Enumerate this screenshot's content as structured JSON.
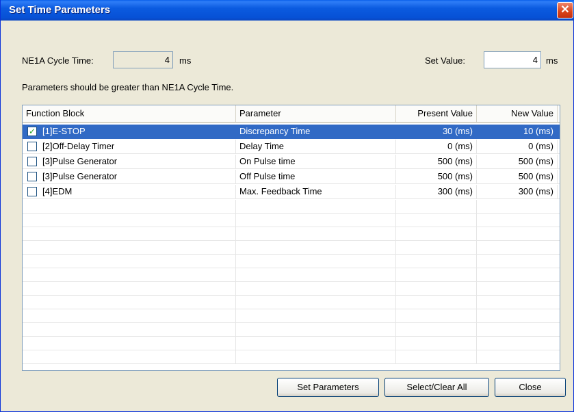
{
  "window": {
    "title": "Set Time Parameters",
    "close_glyph": "✕"
  },
  "cycle": {
    "label": "NE1A Cycle Time:",
    "value": "4",
    "unit": "ms"
  },
  "set_value": {
    "label": "Set Value:",
    "value": "4",
    "unit": "ms"
  },
  "note": "Parameters should be greater than NE1A Cycle Time.",
  "table": {
    "headers": [
      "Function Block",
      "Parameter",
      "Present Value",
      "New Value"
    ],
    "rows": [
      {
        "checked": true,
        "block": "[1]E-STOP",
        "param": "Discrepancy Time",
        "present": "30 (ms)",
        "new": "10 (ms)",
        "check_glyph": "✓"
      },
      {
        "checked": false,
        "block": "[2]Off-Delay Timer",
        "param": "Delay Time",
        "present": "0 (ms)",
        "new": "0 (ms)",
        "check_glyph": ""
      },
      {
        "checked": false,
        "block": "[3]Pulse Generator",
        "param": "On Pulse time",
        "present": "500 (ms)",
        "new": "500 (ms)",
        "check_glyph": ""
      },
      {
        "checked": false,
        "block": "[3]Pulse Generator",
        "param": "Off Pulse time",
        "present": "500 (ms)",
        "new": "500 (ms)",
        "check_glyph": ""
      },
      {
        "checked": false,
        "block": "[4]EDM",
        "param": "Max. Feedback Time",
        "present": "300 (ms)",
        "new": "300 (ms)",
        "check_glyph": ""
      }
    ]
  },
  "buttons": {
    "set": "Set Parameters",
    "select_clear": "Select/Clear All",
    "close": "Close"
  }
}
